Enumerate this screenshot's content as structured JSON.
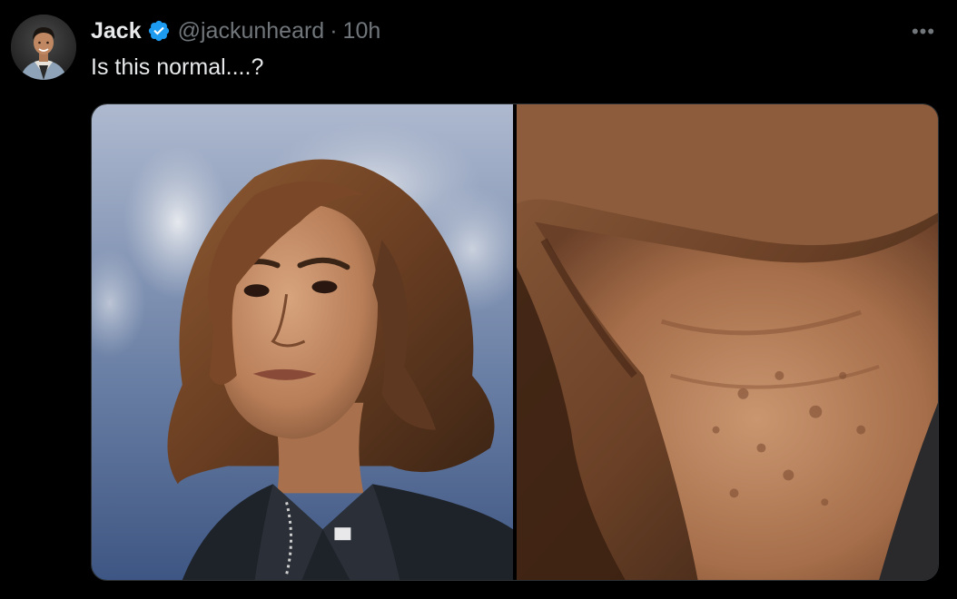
{
  "tweet": {
    "display_name": "Jack",
    "handle": "@jackunheard",
    "separator": "·",
    "time": "10h",
    "text": "Is this normal....?",
    "more_label": "•••",
    "verified_color": "#1d9bf0"
  },
  "media": {
    "items": [
      {
        "icon": "photo-portrait"
      },
      {
        "icon": "photo-closeup"
      }
    ]
  }
}
